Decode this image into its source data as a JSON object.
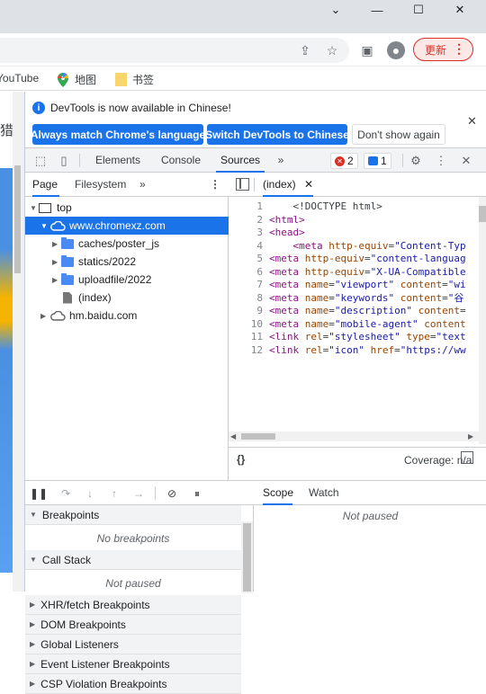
{
  "browser": {
    "update_label": "更新",
    "bookmarks": [
      {
        "label": "YouTube",
        "icon": "youtube-icon"
      },
      {
        "label": "地图",
        "icon": "maps-icon"
      },
      {
        "label": "书签",
        "icon": "folder-icon"
      }
    ],
    "page_edge_text": "猎"
  },
  "devtools": {
    "infobar": {
      "message": "DevTools is now available in Chinese!",
      "buttons": [
        "Always match Chrome's language",
        "Switch DevTools to Chinese",
        "Don't show again"
      ]
    },
    "main_tabs": [
      "Elements",
      "Console",
      "Sources"
    ],
    "active_tab": "Sources",
    "more_tabs": "»",
    "error_count": "2",
    "message_count": "1",
    "navigator": {
      "tabs": [
        "Page",
        "Filesystem"
      ],
      "active": "Page",
      "more": "»",
      "tree": [
        {
          "label": "top",
          "type": "frame",
          "depth": 0,
          "expanded": true
        },
        {
          "label": "www.chromexz.com",
          "type": "domain",
          "depth": 1,
          "expanded": true,
          "selected": true
        },
        {
          "label": "caches/poster_js",
          "type": "folder",
          "depth": 2,
          "expanded": false
        },
        {
          "label": "statics/2022",
          "type": "folder",
          "depth": 2,
          "expanded": false
        },
        {
          "label": "uploadfile/2022",
          "type": "folder",
          "depth": 2,
          "expanded": false
        },
        {
          "label": "(index)",
          "type": "file",
          "depth": 2
        },
        {
          "label": "hm.baidu.com",
          "type": "domain",
          "depth": 1,
          "expanded": false
        }
      ]
    },
    "editor": {
      "tab_label": "(index)",
      "lines": [
        {
          "n": "1",
          "parts": [
            [
              "plain",
              "    <!DOCTYPE html>"
            ]
          ]
        },
        {
          "n": "2",
          "parts": [
            [
              "tag",
              "<html>"
            ]
          ]
        },
        {
          "n": "3",
          "parts": [
            [
              "tag",
              "<head>"
            ]
          ]
        },
        {
          "n": "4",
          "parts": [
            [
              "tag",
              "    <meta "
            ],
            [
              "attr",
              "http-equiv"
            ],
            [
              "plain",
              "="
            ],
            [
              "val",
              "\"Content-Typ"
            ]
          ]
        },
        {
          "n": "5",
          "parts": [
            [
              "tag",
              "<meta "
            ],
            [
              "attr",
              "http-equiv"
            ],
            [
              "plain",
              "="
            ],
            [
              "val",
              "\"content-languag"
            ]
          ]
        },
        {
          "n": "6",
          "parts": [
            [
              "tag",
              "<meta "
            ],
            [
              "attr",
              "http-equiv"
            ],
            [
              "plain",
              "="
            ],
            [
              "val",
              "\"X-UA-Compatible"
            ]
          ]
        },
        {
          "n": "7",
          "parts": [
            [
              "tag",
              "<meta "
            ],
            [
              "attr",
              "name"
            ],
            [
              "plain",
              "="
            ],
            [
              "val",
              "\"viewport\""
            ],
            [
              "attr",
              " content"
            ],
            [
              "plain",
              "="
            ],
            [
              "val",
              "\"wi"
            ]
          ]
        },
        {
          "n": "8",
          "parts": [
            [
              "tag",
              "<meta "
            ],
            [
              "attr",
              "name"
            ],
            [
              "plain",
              "="
            ],
            [
              "val",
              "\"keywords\""
            ],
            [
              "attr",
              " content"
            ],
            [
              "plain",
              "="
            ],
            [
              "val",
              "\"谷"
            ]
          ]
        },
        {
          "n": "9",
          "parts": [
            [
              "tag",
              "<meta "
            ],
            [
              "attr",
              "name"
            ],
            [
              "plain",
              "="
            ],
            [
              "val",
              "\"description\""
            ],
            [
              "attr",
              " content"
            ],
            [
              "plain",
              "="
            ]
          ]
        },
        {
          "n": "10",
          "parts": [
            [
              "tag",
              "<meta "
            ],
            [
              "attr",
              "name"
            ],
            [
              "plain",
              "="
            ],
            [
              "val",
              "\"mobile-agent\""
            ],
            [
              "attr",
              " content"
            ]
          ]
        },
        {
          "n": "11",
          "parts": [
            [
              "tag",
              "<link "
            ],
            [
              "attr",
              "rel"
            ],
            [
              "plain",
              "="
            ],
            [
              "val",
              "\"stylesheet\""
            ],
            [
              "attr",
              " type"
            ],
            [
              "plain",
              "="
            ],
            [
              "val",
              "\"text"
            ]
          ]
        },
        {
          "n": "12",
          "parts": [
            [
              "tag",
              "<link "
            ],
            [
              "attr",
              "rel"
            ],
            [
              "plain",
              "="
            ],
            [
              "val",
              "\"icon\""
            ],
            [
              "attr",
              " href"
            ],
            [
              "plain",
              "="
            ],
            [
              "val",
              "\"https://ww"
            ]
          ]
        }
      ],
      "status_braces": "{}",
      "coverage": "Coverage: n/a"
    },
    "debugger": {
      "sections": [
        {
          "title": "Breakpoints",
          "expanded": true,
          "body": "No breakpoints"
        },
        {
          "title": "Call Stack",
          "expanded": true,
          "body": "Not paused"
        },
        {
          "title": "XHR/fetch Breakpoints",
          "expanded": false
        },
        {
          "title": "DOM Breakpoints",
          "expanded": false
        },
        {
          "title": "Global Listeners",
          "expanded": false
        },
        {
          "title": "Event Listener Breakpoints",
          "expanded": false
        },
        {
          "title": "CSP Violation Breakpoints",
          "expanded": false
        }
      ]
    },
    "scope": {
      "tabs": [
        "Scope",
        "Watch"
      ],
      "active": "Scope",
      "body": "Not paused"
    }
  }
}
